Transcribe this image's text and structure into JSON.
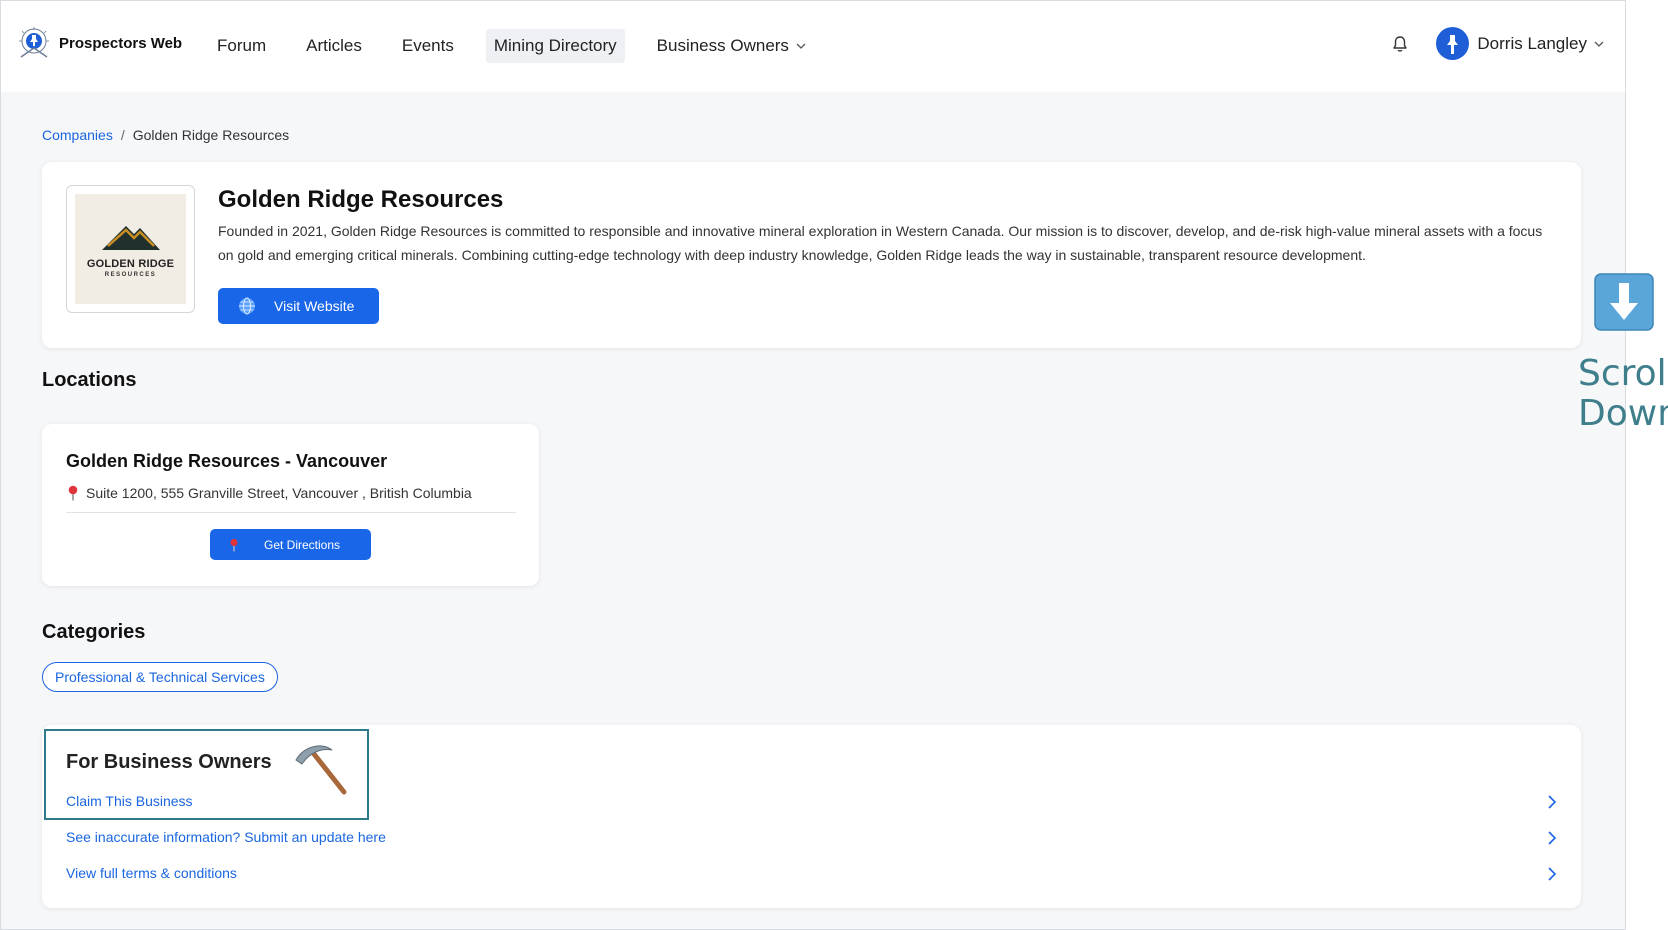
{
  "brand": {
    "name": "Prospectors Web"
  },
  "nav": {
    "items": [
      {
        "label": "Forum"
      },
      {
        "label": "Articles"
      },
      {
        "label": "Events"
      },
      {
        "label": "Mining Directory",
        "active": true
      },
      {
        "label": "Business Owners",
        "dropdown": true
      }
    ]
  },
  "user": {
    "name": "Dorris Langley"
  },
  "breadcrumb": {
    "root": "Companies",
    "separator": "/",
    "current": "Golden Ridge Resources"
  },
  "company": {
    "logo_text_1": "GOLDEN RIDGE",
    "logo_text_2": "RESOURCES",
    "name": "Golden Ridge Resources",
    "description": "Founded in 2021, Golden Ridge Resources is committed to responsible and innovative mineral exploration in Western Canada. Our mission is to discover, develop, and de-risk high-value mineral assets with a focus on gold and emerging critical minerals. Combining cutting-edge technology with deep industry knowledge, Golden Ridge leads the way in sustainable, transparent resource development.",
    "visit_label": "Visit Website"
  },
  "locations": {
    "title": "Locations",
    "items": [
      {
        "name": "Golden Ridge Resources - Vancouver",
        "address": "Suite 1200, 555 Granville Street, Vancouver , British Columbia",
        "directions_label": "Get Directions"
      }
    ]
  },
  "categories": {
    "title": "Categories",
    "items": [
      "Professional & Technical Services"
    ]
  },
  "owners": {
    "title": "For Business Owners",
    "links": [
      "Claim This Business",
      "See inaccurate information? Submit an update here",
      "View full terms & conditions"
    ]
  },
  "scroll_hint": {
    "line1": "Scroll",
    "line2": "Down"
  },
  "colors": {
    "primary": "#1a66e8",
    "link": "#1a66e0",
    "highlight_border": "#2d7a88",
    "hint_text": "#3f7f8c"
  }
}
